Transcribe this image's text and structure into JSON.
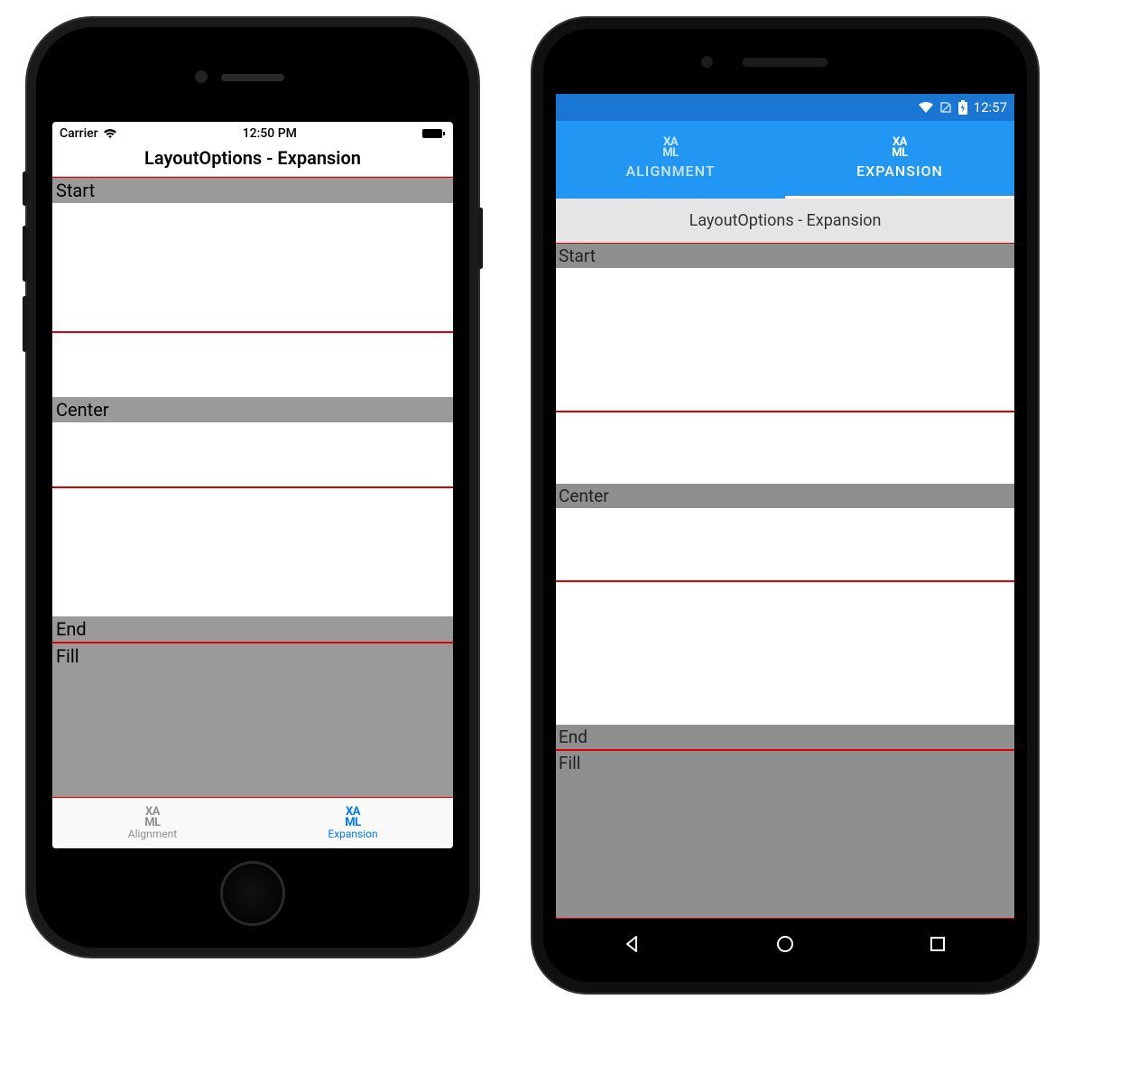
{
  "colors": {
    "ios_accent": "#007aff",
    "android_primary": "#2196f3",
    "android_primary_dark": "#1976d2",
    "slot_border": "#d00",
    "gray_label": "#9a9a9a"
  },
  "ios": {
    "statusbar": {
      "carrier": "Carrier",
      "time": "12:50 PM"
    },
    "title": "LayoutOptions - Expansion",
    "slots": {
      "start": "Start",
      "center": "Center",
      "end": "End",
      "fill": "Fill"
    },
    "tabs": [
      {
        "icon": "XA\nML",
        "label": "Alignment",
        "active": false
      },
      {
        "icon": "XA\nML",
        "label": "Expansion",
        "active": true
      }
    ]
  },
  "android": {
    "statusbar": {
      "time": "12:57"
    },
    "tabs": [
      {
        "icon": "XA\nML",
        "label": "ALIGNMENT",
        "active": false
      },
      {
        "icon": "XA\nML",
        "label": "EXPANSION",
        "active": true
      }
    ],
    "title": "LayoutOptions - Expansion",
    "slots": {
      "start": "Start",
      "center": "Center",
      "end": "End",
      "fill": "Fill"
    }
  }
}
